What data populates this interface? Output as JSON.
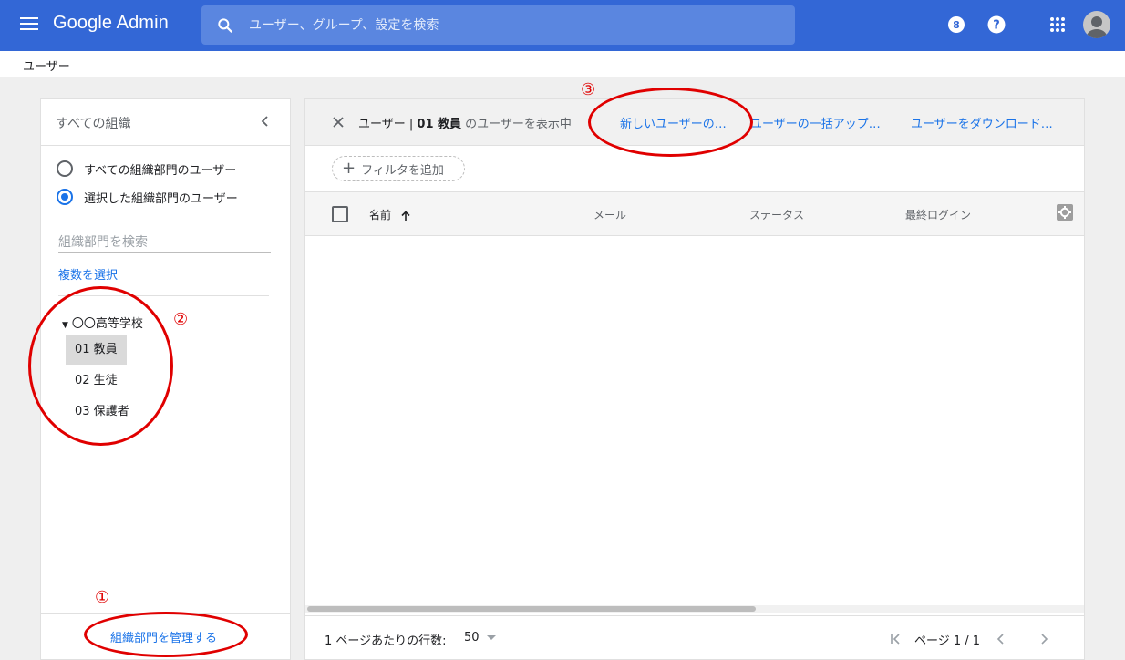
{
  "topbar": {
    "brand": "Google Admin",
    "search_placeholder": "ユーザー、グループ、設定を検索",
    "icons": [
      "menu-icon",
      "search-icon",
      "support-badge-icon",
      "help-icon",
      "apps-grid-icon",
      "account-avatar"
    ]
  },
  "breadcrumb": {
    "label": "ユーザー"
  },
  "org_panel": {
    "title": "すべての組織",
    "radio_all": "すべての組織部門のユーザー",
    "radio_selected": "選択した組織部門のユーザー",
    "selected_radio": "radio_selected",
    "search_placeholder": "組織部門を検索",
    "multi_select": "複数を選択",
    "tree_root": "〇〇高等学校",
    "tree_items": [
      "01 教員",
      "02 生徒",
      "03 保護者"
    ],
    "selected_item": "01 教員",
    "manage_link": "組織部門を管理する"
  },
  "main_panel": {
    "filter_prefix": "ユーザー |",
    "filter_org": "01 教員",
    "filter_suffix": "のユーザーを表示中",
    "actions": [
      "新しいユーザーの…",
      "ユーザーの一括アップ…",
      "ユーザーをダウンロード…"
    ],
    "add_filter": "フィルタを追加",
    "columns": [
      "名前",
      "メール",
      "ステータス",
      "最終ログイン"
    ],
    "sort_column": "名前",
    "sort_direction": "ascending",
    "rows_per_page_label": "1 ページあたりの行数:",
    "rows_per_page_value": "50",
    "page_indicator": "ページ 1 / 1"
  },
  "annotations": {
    "color": "#e00000",
    "labels": [
      "①",
      "②",
      "③"
    ]
  },
  "colors": {
    "topbar": "#3367d6",
    "link": "#1a73e8",
    "selected_item_bg": "#dadada"
  }
}
